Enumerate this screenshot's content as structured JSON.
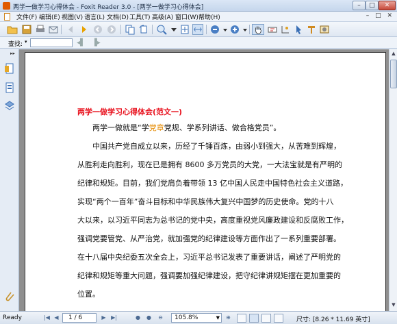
{
  "window": {
    "title": "两学一做学习心得体会 - Foxit Reader 3.0 - [两学一做学习心得体会]",
    "min_glyph": "–",
    "max_glyph": "□",
    "close_glyph": "✕"
  },
  "menu": {
    "items": [
      "文件(F)",
      "编辑(E)",
      "视图(V)",
      "语言(L)",
      "文档(D)",
      "工具(T)",
      "高级(A)",
      "窗口(W)",
      "帮助(H)"
    ],
    "right_controls": "– □ ✕"
  },
  "findbar": {
    "label": "查找:",
    "value": ""
  },
  "document": {
    "heading": "两学一做学习心得体会(范文一)",
    "lines": [
      "　　两学一做就是“学党章党规、学系列讲话、做合格党员”。",
      "　　中国共产党自成立以来，历经了千锤百炼，由弱小到强大，从苦难到辉煌，",
      "从胜利走向胜利，现在已是拥有 8600 多万党员的大党，一大法宝就是有严明的",
      "纪律和规矩。目前，我们党肩负着带领 13 亿中国人民走中国特色社会主义道路，",
      "实现“两个一百年”奋斗目标和中华民族伟大复兴中国梦的历史使命。党的十八",
      "大以来，以习近平同志为总书记的党中央，高度重视党风廉政建设和反腐败工作，",
      "强调党要管党、从严治党，就加强党的纪律建设等方面作出了一系列重要部署。",
      "在十八届中央纪委五次全会上，习近平总书记发表了重要讲话，阐述了严明党的",
      "纪律和规矩等重大问题，强调要加强纪律建设，把守纪律讲规矩摆在更加重要的",
      "位置。"
    ]
  },
  "status": {
    "ready": "Ready",
    "page": "1 / 6",
    "zoom": "105.8%",
    "size": "尺寸: [8.26 * 11.69 英寸]"
  },
  "colors": {
    "heading": "#e8101c",
    "highlight": "#e58a00"
  }
}
